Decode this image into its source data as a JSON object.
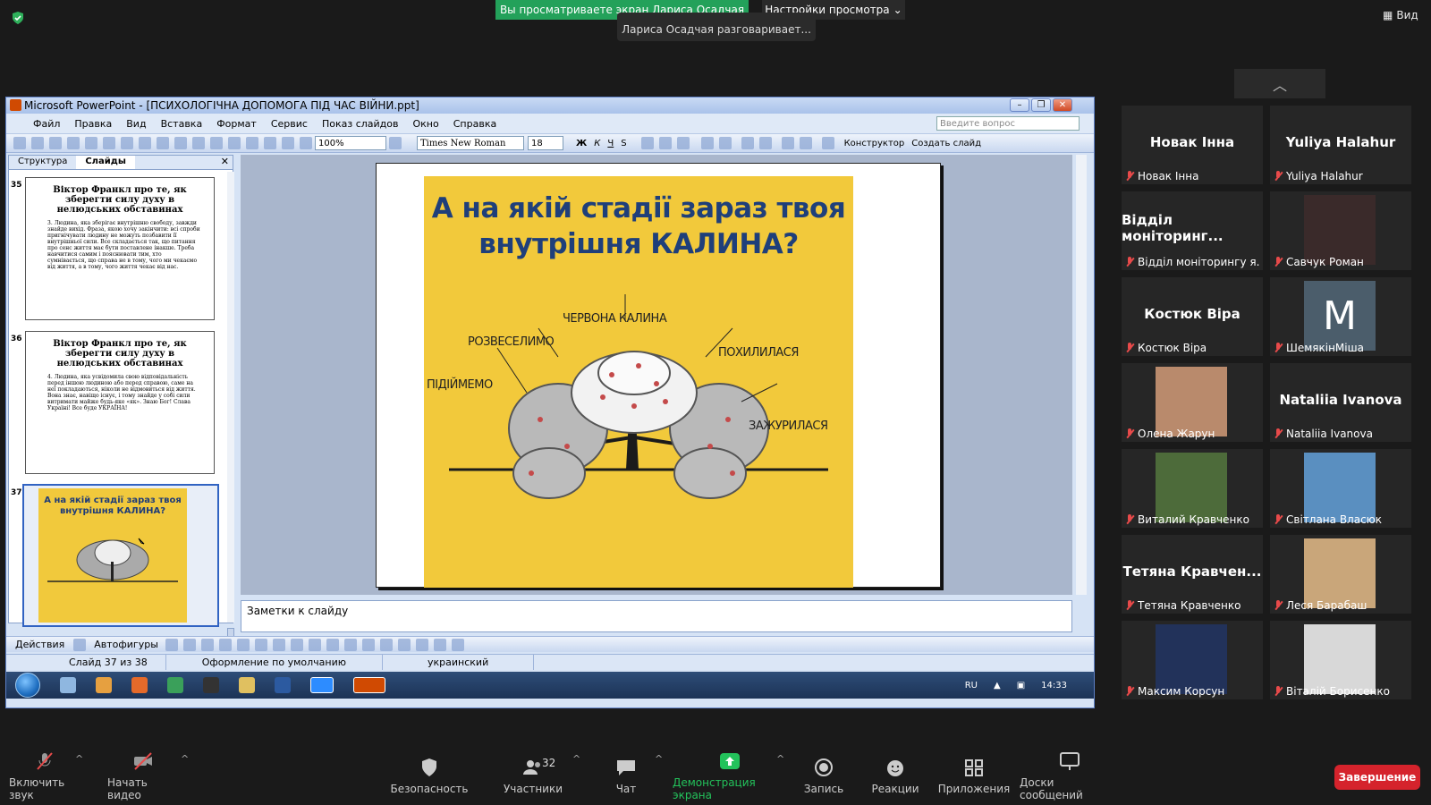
{
  "zoom": {
    "share_banner": "Вы просматриваете экран Лариса Осадчая",
    "view_settings": "Настройки просмотра",
    "speaking": "Лариса Осадчая разговаривает...",
    "view_button": "Вид"
  },
  "ppt": {
    "window_title": "Microsoft PowerPoint - [ПСИХОЛОГІЧНА ДОПОМОГА ПІД ЧАС ВІЙНИ.ppt]",
    "menu": [
      "Файл",
      "Правка",
      "Вид",
      "Вставка",
      "Формат",
      "Сервис",
      "Показ слайдов",
      "Окно",
      "Справка"
    ],
    "ask_placeholder": "Введите вопрос",
    "zoom": "100%",
    "font": "Times New Roman",
    "font_size": "18",
    "bold": "Ж",
    "italic": "К",
    "underline": "Ч",
    "shadow": "S",
    "designer": "Конструктор",
    "new_slide": "Создать слайд",
    "pane_tabs": [
      "Структура",
      "Слайды"
    ],
    "thumbs": [
      {
        "num": "35",
        "title": "Віктор Франкл про те, як зберегти силу духу в нелюдських обставинах",
        "body": "3. Людина, яка зберігає внутрішню свободу, завжди знайде вихід. Фраза, якою хочу закінчити: всі спроби пригнічувати людину не можуть позбавити її внутрішньої сили. Все складається так, що питання про сенс життя має бути поставлене інакше. Треба навчитися самим і пояснювати тим, хто сумнівається, що справа не в тому, чого ми чекаємо від життя, а в тому, чого життя чекає від нас."
      },
      {
        "num": "36",
        "title": "Віктор Франкл про те, як зберегти силу духу в нелюдських обставинах",
        "body": "4. Людина, яка усвідомила свою відповідальність перед іншою людиною або перед справою, саме на неї покладаються, ніколи не відмовиться від життя. Вона знає, навіщо існує, і тому знайде у собі сили витримати майже будь-яке «як». Знаю Бог! Слава Україні! Все буде УКРАЇНА!"
      },
      {
        "num": "37",
        "title": "А на якій стадії зараз твоя внутрішня КАЛИНА?"
      }
    ],
    "slide": {
      "title": "А на якій стадії  зараз твоя внутрішня КАЛИНА?",
      "labels": {
        "center": "ЧЕРВОНА КАЛИНА",
        "left_up": "РОЗВЕСЕЛИМО",
        "left": "ПІДІЙМЕМО",
        "right_up": "ПОХИЛИЛАСЯ",
        "right": "ЗАЖУРИЛАСЯ"
      }
    },
    "notes_placeholder": "Заметки к слайду",
    "draw_actions": "Действия",
    "autoshapes": "Автофигуры",
    "status": {
      "slide": "Слайд 37 из 38",
      "design": "Оформление по умолчанию",
      "lang": "украинский"
    },
    "tray": {
      "lang": "RU",
      "time": "14:33"
    }
  },
  "participants": [
    {
      "name": "Новак Інна",
      "label": "Новак Інна",
      "type": "name"
    },
    {
      "name": "Yuliya Halahur",
      "label": "Yuliya Halahur",
      "type": "name"
    },
    {
      "name": "Відділ моніторинг...",
      "label": "Відділ моніторингу я...",
      "type": "name"
    },
    {
      "name": "",
      "label": "Савчук Роман",
      "type": "photo",
      "color": "#3a2a2a"
    },
    {
      "name": "Костюк Віра",
      "label": "Костюк Віра",
      "type": "name"
    },
    {
      "name": "M",
      "label": "ШемякінМіша",
      "type": "mono"
    },
    {
      "name": "",
      "label": "Олена Жарун",
      "type": "photo",
      "color": "#b98a6c"
    },
    {
      "name": "Nataliia Ivanova",
      "label": "Nataliia Ivanova",
      "type": "name"
    },
    {
      "name": "",
      "label": "Виталий Кравченко",
      "type": "photo",
      "color": "#4d6b3a"
    },
    {
      "name": "",
      "label": "Світлана Власюк",
      "type": "photo",
      "color": "#5a8fc0"
    },
    {
      "name": "Тетяна  Кравчен...",
      "label": "Тетяна Кравченко",
      "type": "name"
    },
    {
      "name": "",
      "label": "Леся Барабаш",
      "type": "photo",
      "color": "#c9a67a"
    },
    {
      "name": "",
      "label": "Максим Корсун",
      "type": "photo",
      "color": "#22325a"
    },
    {
      "name": "",
      "label": "Віталій Борисенко",
      "type": "photo",
      "color": "#d8d8d8"
    }
  ],
  "bottom": {
    "mute": "Включить звук",
    "video": "Начать видео",
    "security": "Безопасность",
    "participants": "Участники",
    "participants_count": "32",
    "chat": "Чат",
    "share": "Демонстрация экрана",
    "record": "Запись",
    "reactions": "Реакции",
    "apps": "Приложения",
    "whiteboards": "Доски сообщений",
    "end": "Завершение"
  }
}
